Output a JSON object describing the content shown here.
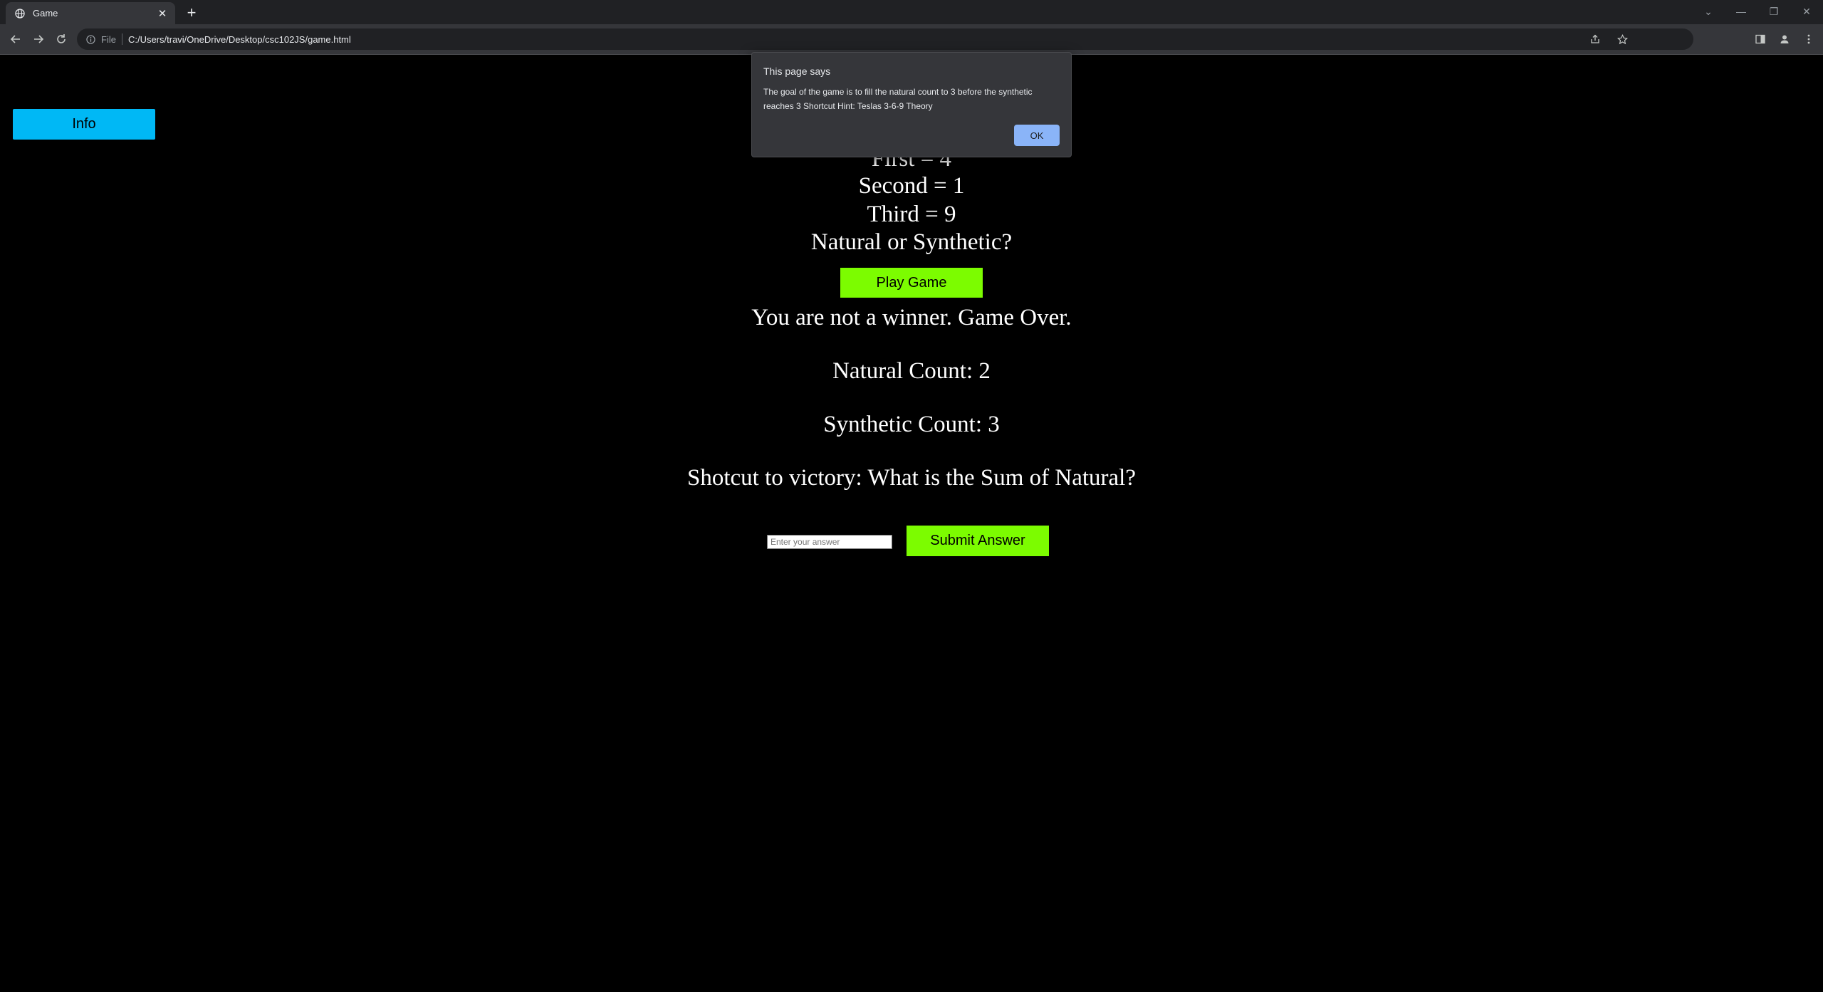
{
  "browser": {
    "tab_title": "Game",
    "url_scheme": "File",
    "url": "C:/Users/travi/OneDrive/Desktop/csc102JS/game.html"
  },
  "page": {
    "info_button": "Info",
    "lines": {
      "first": "First = 4",
      "second": "Second = 1",
      "third": "Third = 9",
      "question": "Natural or Synthetic?"
    },
    "play_button": "Play Game",
    "result": "You are not a winner. Game Over.",
    "natural_count": "Natural Count: 2",
    "synthetic_count": "Synthetic Count: 3",
    "shortcut": "Shotcut to victory: What is the Sum of Natural?",
    "answer_placeholder": "Enter your answer",
    "submit_button": "Submit Answer"
  },
  "dialog": {
    "title": "This page says",
    "message": "The goal of the game is to fill the natural count to 3 before the synthetic reaches 3 Shortcut Hint: Teslas 3-6-9 Theory",
    "ok": "OK"
  },
  "colors": {
    "background": "#000000",
    "info_button": "#00b8f5",
    "green_button": "#7cfc00"
  }
}
